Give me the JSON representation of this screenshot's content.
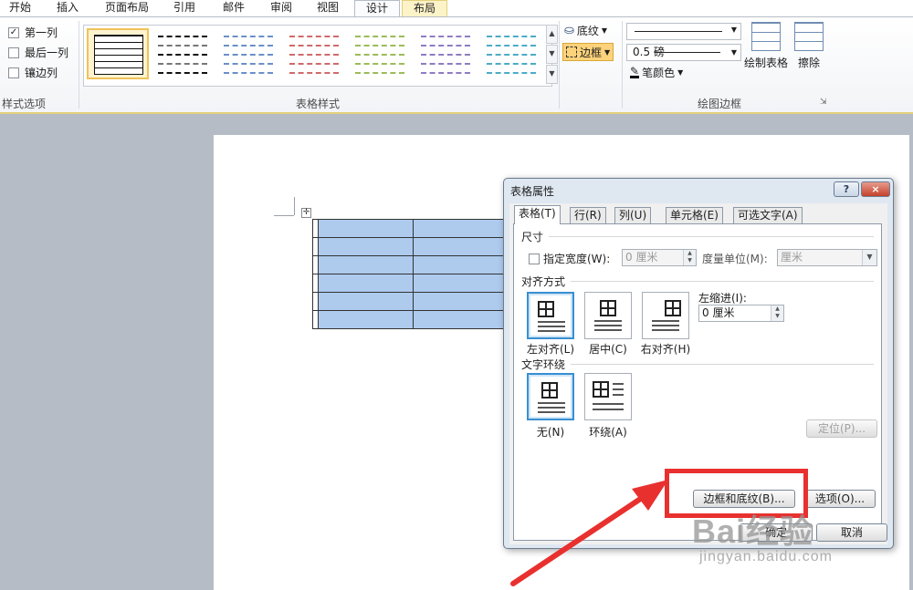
{
  "ribbon": {
    "tabs": [
      "开始",
      "插入",
      "页面布局",
      "引用",
      "邮件",
      "审阅",
      "视图",
      "设计",
      "布局"
    ],
    "active_tab": "设计",
    "style_options": {
      "first_column": "第一列",
      "last_column": "最后一列",
      "banded_columns": "镶边列",
      "group_label": "样式选项"
    },
    "table_styles": {
      "group_label": "表格样式"
    },
    "shading_label": "底纹",
    "borders_label": "边框",
    "draw_borders": {
      "line_weight": "0.5 磅",
      "pen_color_label": "笔颜色",
      "draw_table_label": "绘制表格",
      "eraser_label": "擦除",
      "group_label": "绘图边框"
    }
  },
  "dialog": {
    "title": "表格属性",
    "help": "?",
    "close": "×",
    "tabs": [
      "表格(T)",
      "行(R)",
      "列(U)",
      "单元格(E)",
      "可选文字(A)"
    ],
    "size": {
      "section": "尺寸",
      "preferred_width_label": "指定宽度(W):",
      "width_value": "0 厘米",
      "measure_label": "度量单位(M):",
      "measure_value": "厘米"
    },
    "alignment": {
      "section": "对齐方式",
      "left": "左对齐(L)",
      "center": "居中(C)",
      "right": "右对齐(H)",
      "indent_label": "左缩进(I):",
      "indent_value": "0 厘米"
    },
    "wrapping": {
      "section": "文字环绕",
      "none": "无(N)",
      "around": "环绕(A)",
      "positioning": "定位(P)..."
    },
    "borders_shading_button": "边框和底纹(B)...",
    "options_button": "选项(O)...",
    "ok_button": "确定",
    "cancel_button": "取消"
  },
  "watermark": {
    "brand": "Bai经验",
    "url": "jingyan.baidu.com"
  }
}
